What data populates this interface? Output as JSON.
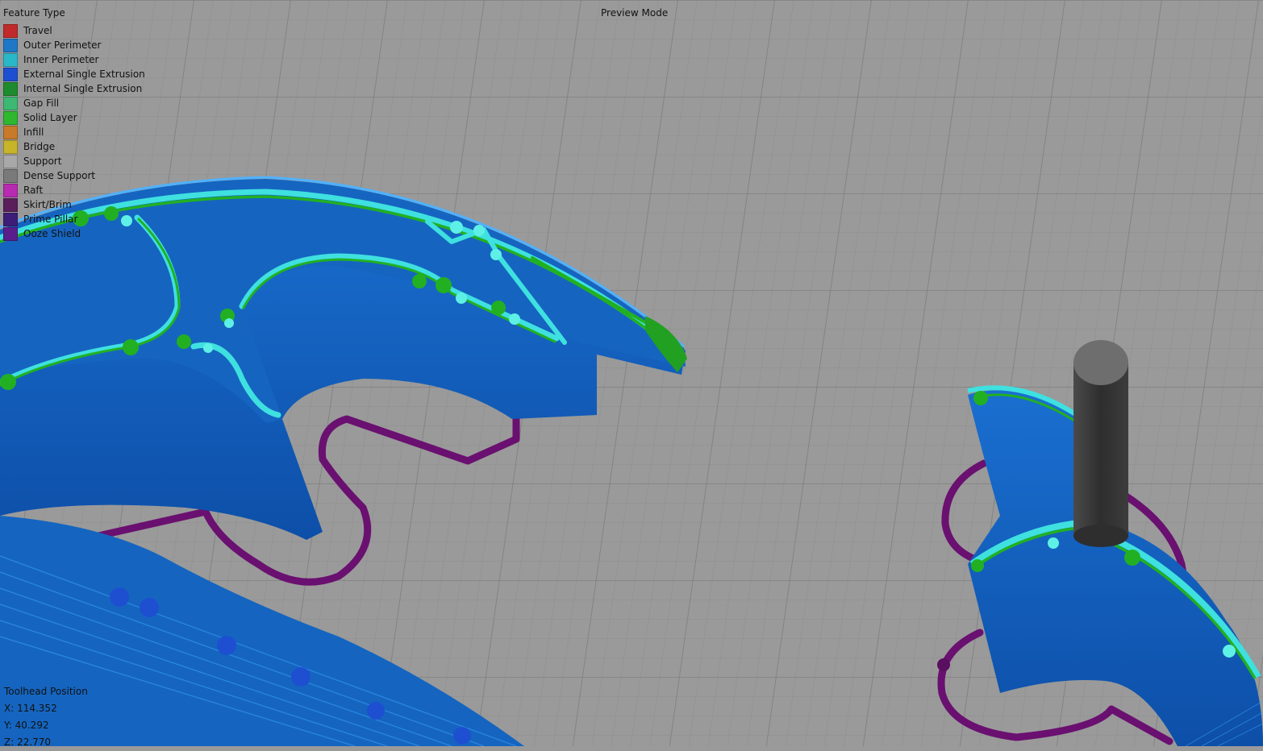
{
  "legend": {
    "title": "Feature Type",
    "items": [
      {
        "label": "Travel",
        "color": "#c02a2a"
      },
      {
        "label": "Outer Perimeter",
        "color": "#1f77c8"
      },
      {
        "label": "Inner Perimeter",
        "color": "#2ab8c8"
      },
      {
        "label": "External Single Extrusion",
        "color": "#1e4fd0"
      },
      {
        "label": "Internal Single Extrusion",
        "color": "#1e8c2e"
      },
      {
        "label": "Gap Fill",
        "color": "#3cb873"
      },
      {
        "label": "Solid Layer",
        "color": "#2fb82f"
      },
      {
        "label": "Infill",
        "color": "#c87a2a"
      },
      {
        "label": "Bridge",
        "color": "#c8b42a"
      },
      {
        "label": "Support",
        "color": "#a8a8a8"
      },
      {
        "label": "Dense Support",
        "color": "#7a7a7a"
      },
      {
        "label": "Raft",
        "color": "#b82ab0"
      },
      {
        "label": "Skirt/Brim",
        "color": "#5a1e5a"
      },
      {
        "label": "Prime Pillar",
        "color": "#3c1e78"
      },
      {
        "label": "Ooze Shield",
        "color": "#5a1e8c"
      }
    ]
  },
  "mode_label": "Preview Mode",
  "toolhead": {
    "title": "Toolhead Position",
    "x": "X: 114.352",
    "y": "Y: 40.292",
    "z": "Z: 22.770"
  },
  "colors": {
    "background": "#9a9a9a",
    "grid": "#8a8a8a",
    "perimeter_blue": "#1565c0",
    "inner_cyan": "#3fe0e0",
    "solid_green": "#22b022",
    "skirt_purple": "#6a1070",
    "pillar": "#3a3a3a"
  }
}
